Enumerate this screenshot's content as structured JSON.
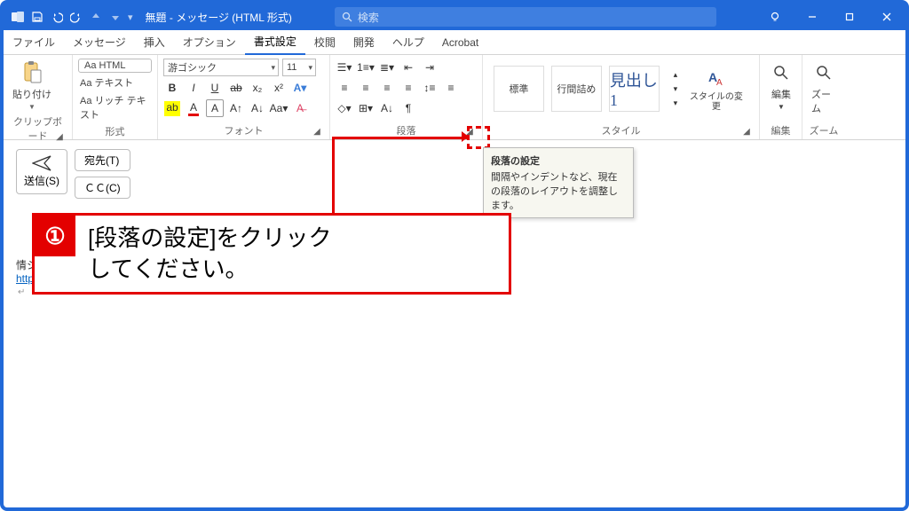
{
  "titlebar": {
    "title": "無題 - メッセージ (HTML 形式)",
    "search_placeholder": "検索"
  },
  "tabs": {
    "file": "ファイル",
    "message": "メッセージ",
    "insert": "挿入",
    "options": "オプション",
    "format": "書式設定",
    "review": "校閲",
    "developer": "開発",
    "help": "ヘルプ",
    "acrobat": "Acrobat"
  },
  "ribbon": {
    "clipboard": {
      "label": "クリップボード",
      "paste": "貼り付け"
    },
    "format_text": {
      "label": "形式",
      "aa_html": "Aa HTML",
      "aa_text": "Aa テキスト",
      "aa_rich": "Aa リッチ テキスト"
    },
    "font": {
      "label": "フォント",
      "family": "游ゴシック",
      "size": "11"
    },
    "paragraph": {
      "label": "段落"
    },
    "styles": {
      "label": "スタイル",
      "normal": "標準",
      "nospace": "行間詰め",
      "heading1": "見出し 1",
      "change": "スタイルの変更"
    },
    "editing": {
      "label": "編集",
      "btn": "編集"
    },
    "zoom": {
      "label": "ズーム",
      "btn": "ズーム"
    }
  },
  "tooltip": {
    "title": "段落の設定",
    "body": "間隔やインデントなど、現在の段落のレイアウトを調整します。"
  },
  "compose": {
    "send": "送信(S)",
    "to": "宛先(T)",
    "cc": "ＣＣ(C)"
  },
  "body": {
    "line1": "情シスの自由帳",
    "link": "https://jo-sys.net/"
  },
  "annotation": {
    "num": "①",
    "text_l1": "[段落の設定]をクリック",
    "text_l2": "してください。"
  }
}
